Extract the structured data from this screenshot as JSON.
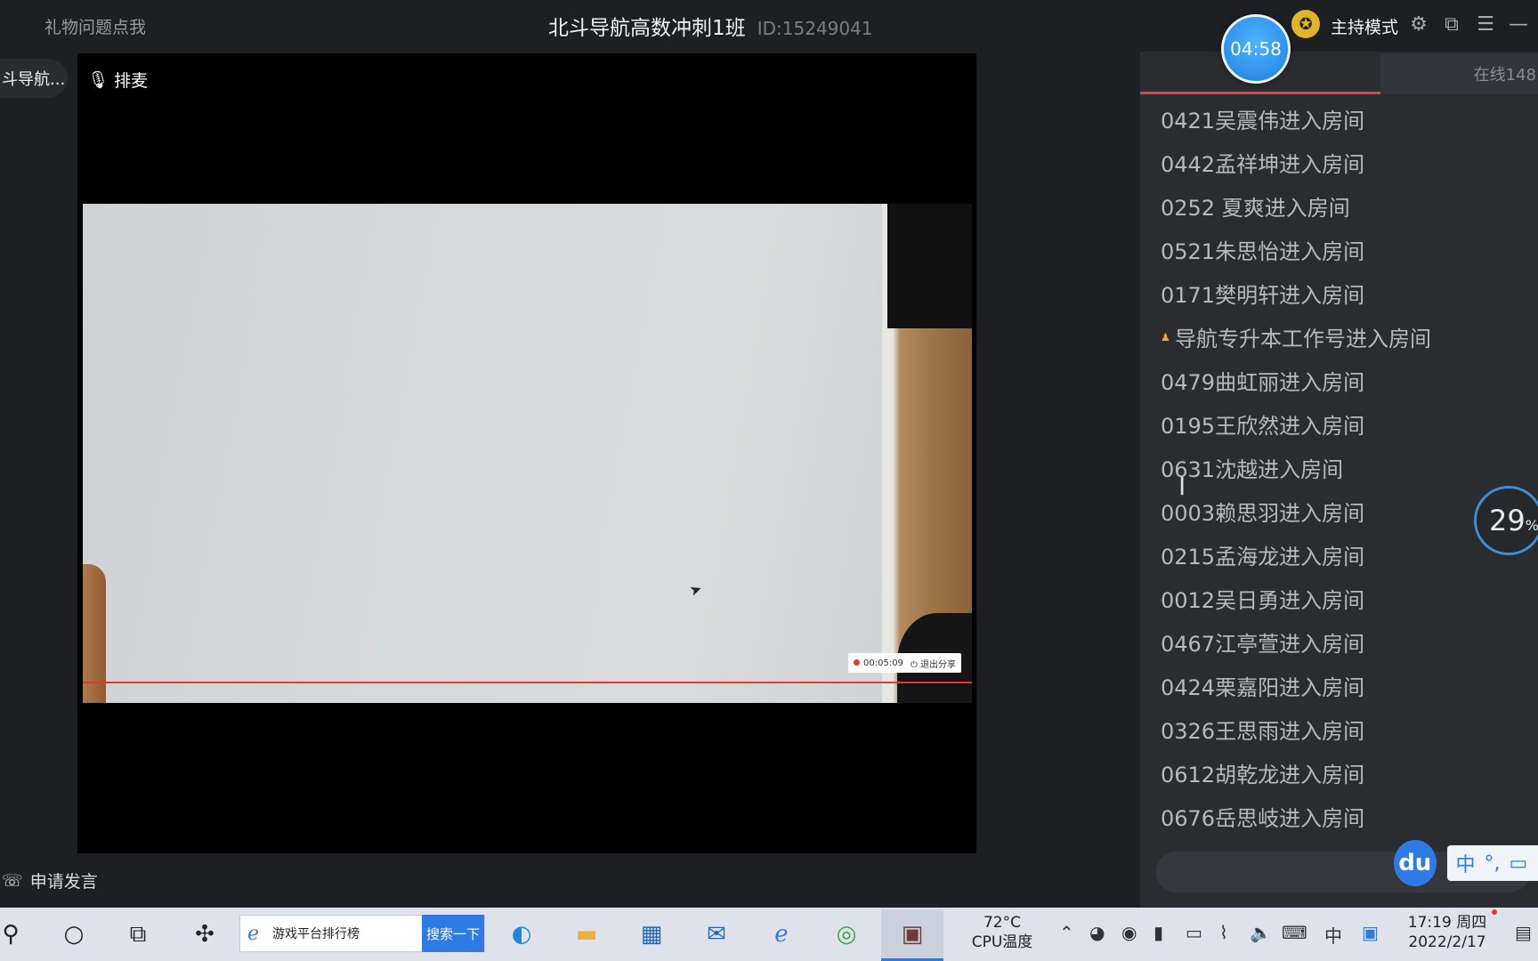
{
  "header": {
    "gift_link": "礼物问题点我",
    "room_title": "北斗导航高数冲刺1班",
    "room_id": "ID:15249041",
    "timer": "04:58",
    "host_mode": "主持模式"
  },
  "left": {
    "course_pill": "斗导航...",
    "queue_mic": "排麦",
    "apply_speak": "申请发言"
  },
  "video": {
    "share_time": "00:05:09",
    "exit_share": "退出分享"
  },
  "chat": {
    "tab_online": "在线148",
    "messages": [
      {
        "user": "0421吴震伟",
        "action": "进入房间"
      },
      {
        "user": "0442孟祥坤",
        "action": "进入房间"
      },
      {
        "user": "0252 夏爽",
        "action": "进入房间"
      },
      {
        "user": "0521朱思怡",
        "action": "进入房间"
      },
      {
        "user": "0171樊明轩",
        "action": "进入房间"
      },
      {
        "user": "导航专升本工作号",
        "action": "进入房间",
        "badge": true
      },
      {
        "user": "0479曲虹丽",
        "action": "进入房间"
      },
      {
        "user": "0195王欣然",
        "action": "进入房间"
      },
      {
        "user": "0631沈越",
        "action": "进入房间"
      },
      {
        "user": "0003赖思羽",
        "action": "进入房间"
      },
      {
        "user": "0215孟海龙",
        "action": "进入房间"
      },
      {
        "user": "0012吴日勇",
        "action": "进入房间"
      },
      {
        "user": "0467江亭萱",
        "action": "进入房间"
      },
      {
        "user": "0424栗嘉阳",
        "action": "进入房间"
      },
      {
        "user": "0326王思雨",
        "action": "进入房间"
      },
      {
        "user": "0612胡乾龙",
        "action": "进入房间"
      },
      {
        "user": "0676岳思岐",
        "action": "进入房间"
      }
    ]
  },
  "overlay": {
    "cpu_percent": "29",
    "cpu_unit": "%",
    "ime_logo": "du",
    "ime_lang": "中"
  },
  "taskbar": {
    "search_text": "游戏平台排行榜",
    "search_button": "搜索一下",
    "temp_value": "72°C",
    "temp_label": "CPU温度",
    "time": "17:19 周四",
    "date": "2022/2/17",
    "tray_lang": "中"
  }
}
